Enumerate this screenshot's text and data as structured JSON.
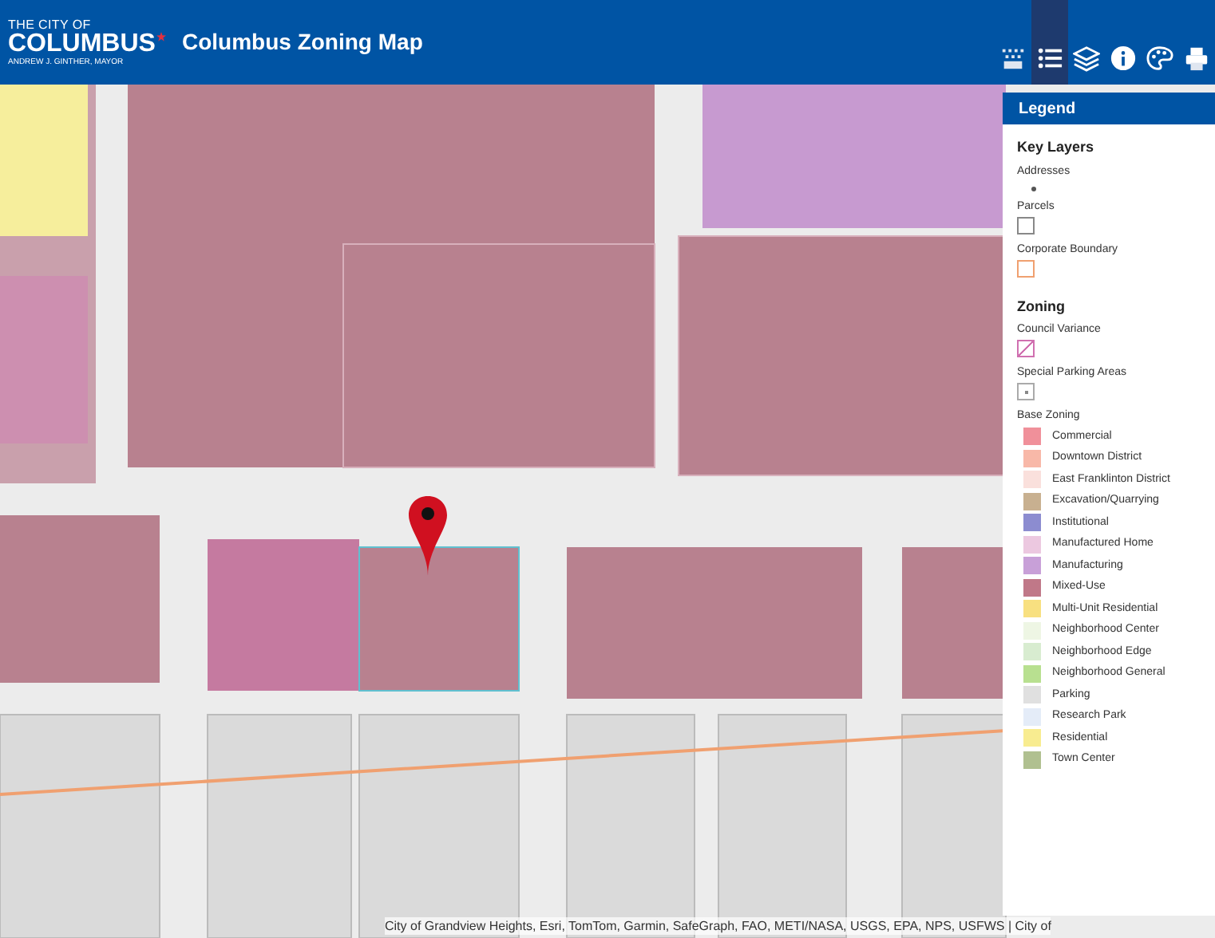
{
  "header": {
    "logo": {
      "line_1": "THE CITY OF",
      "line_2": "COLUMBUS",
      "line_3": "ANDREW J. GINTHER, MAYOR"
    },
    "title": "Columbus Zoning Map"
  },
  "toolbar": [
    {
      "selected": false
    },
    {
      "selected": true
    },
    {
      "selected": false
    },
    {
      "selected": false
    },
    {
      "selected": false
    },
    {
      "selected": false
    }
  ],
  "legend": {
    "title": "Legend",
    "sections": [
      {
        "heading": "Key Layers",
        "items": [
          {
            "label": "Addresses",
            "kind": "dot"
          },
          {
            "label": "Parcels",
            "kind": "outline",
            "color": "#888888"
          },
          {
            "label": "Corporate Boundary",
            "kind": "outline",
            "color": "#f0a070"
          }
        ]
      },
      {
        "heading": "Zoning",
        "items": [
          {
            "label": "Council Variance",
            "kind": "hatch",
            "color": "#d070b0"
          },
          {
            "label": "Special Parking Areas",
            "kind": "dotbox",
            "color": "#aaaaaa"
          }
        ]
      }
    ],
    "base_zoning_label": "Base Zoning",
    "base_zoning": [
      {
        "label": "Commercial",
        "color": "#f0909a"
      },
      {
        "label": "Downtown District",
        "color": "#f8b8a8"
      },
      {
        "label": "East Franklinton District",
        "color": "#fae0dc"
      },
      {
        "label": "Excavation/Quarrying",
        "color": "#c8b090"
      },
      {
        "label": "Institutional",
        "color": "#8c8cd0"
      },
      {
        "label": "Manufactured Home",
        "color": "#ecc8e0"
      },
      {
        "label": "Manufacturing",
        "color": "#c8a0d8"
      },
      {
        "label": "Mixed-Use",
        "color": "#c07888"
      },
      {
        "label": "Multi-Unit Residential",
        "color": "#f8e080"
      },
      {
        "label": "Neighborhood Center",
        "color": "#eef6e4"
      },
      {
        "label": "Neighborhood Edge",
        "color": "#d8ecd0"
      },
      {
        "label": "Neighborhood General",
        "color": "#b8e090"
      },
      {
        "label": "Parking",
        "color": "#e0e0e0"
      },
      {
        "label": "Research Park",
        "color": "#e4ecf8"
      },
      {
        "label": "Residential",
        "color": "#f8ec90"
      },
      {
        "label": "Town Center",
        "color": "#b0c090"
      }
    ]
  },
  "attribution": "City of Grandview Heights, Esri, TomTom, Garmin, SafeGraph, FAO, METI/NASA, USGS, EPA, NPS, USFWS | City of"
}
